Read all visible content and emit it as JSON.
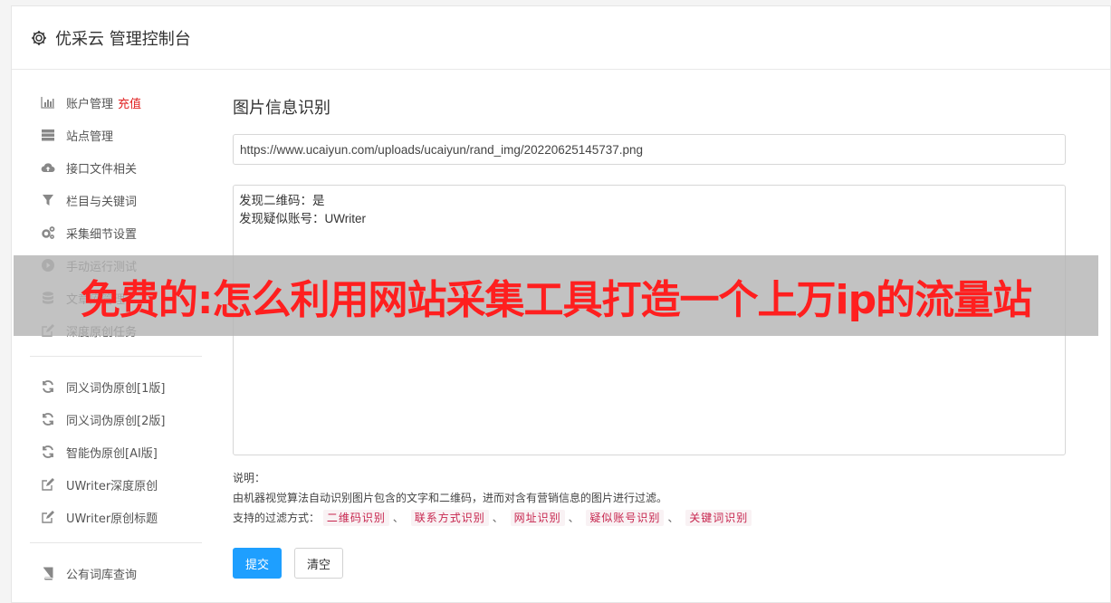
{
  "header": {
    "title": "优采云 管理控制台"
  },
  "sidebar": {
    "items": [
      {
        "label": "账户管理",
        "extra": "充值",
        "icon": "bar-chart-icon"
      },
      {
        "label": "站点管理",
        "icon": "server-icon"
      },
      {
        "label": "接口文件相关",
        "icon": "cloud-upload-icon"
      },
      {
        "label": "栏目与关键词",
        "icon": "filter-icon"
      },
      {
        "label": "采集细节设置",
        "icon": "cogs-icon"
      },
      {
        "label": "手动运行测试",
        "icon": "play-circle-icon"
      },
      {
        "label": "文章库管理",
        "icon": "database-icon"
      },
      {
        "label": "深度原创任务",
        "icon": "edit-icon"
      }
    ],
    "items2": [
      {
        "label": "同义词伪原创[1版]",
        "icon": "refresh-icon"
      },
      {
        "label": "同义词伪原创[2版]",
        "icon": "refresh-icon"
      },
      {
        "label": "智能伪原创[AI版]",
        "icon": "refresh-icon"
      },
      {
        "label": "UWriter深度原创",
        "icon": "edit-icon"
      },
      {
        "label": "UWriter原创标题",
        "icon": "edit-icon"
      }
    ],
    "items3": [
      {
        "label": "公有词库查询",
        "icon": "book-icon"
      }
    ]
  },
  "main": {
    "title": "图片信息识别",
    "url_value": "https://www.ucaiyun.com/uploads/ucaiyun/rand_img/20220625145737.png",
    "result_lines": [
      "发现二维码：是",
      "发现疑似账号：UWriter"
    ],
    "desc_label": "说明：",
    "desc_text": "由机器视觉算法自动识别图片包含的文字和二维码，进而对含有营销信息的图片进行过滤。",
    "filter_label": "支持的过滤方式：",
    "filters": [
      "二维码识别",
      "联系方式识别",
      "网址识别",
      "疑似账号识别",
      "关键词识别"
    ],
    "submit_label": "提交",
    "clear_label": "清空"
  },
  "overlay": {
    "text": "免费的:怎么利用网站采集工具打造一个上万ip的流量站"
  }
}
